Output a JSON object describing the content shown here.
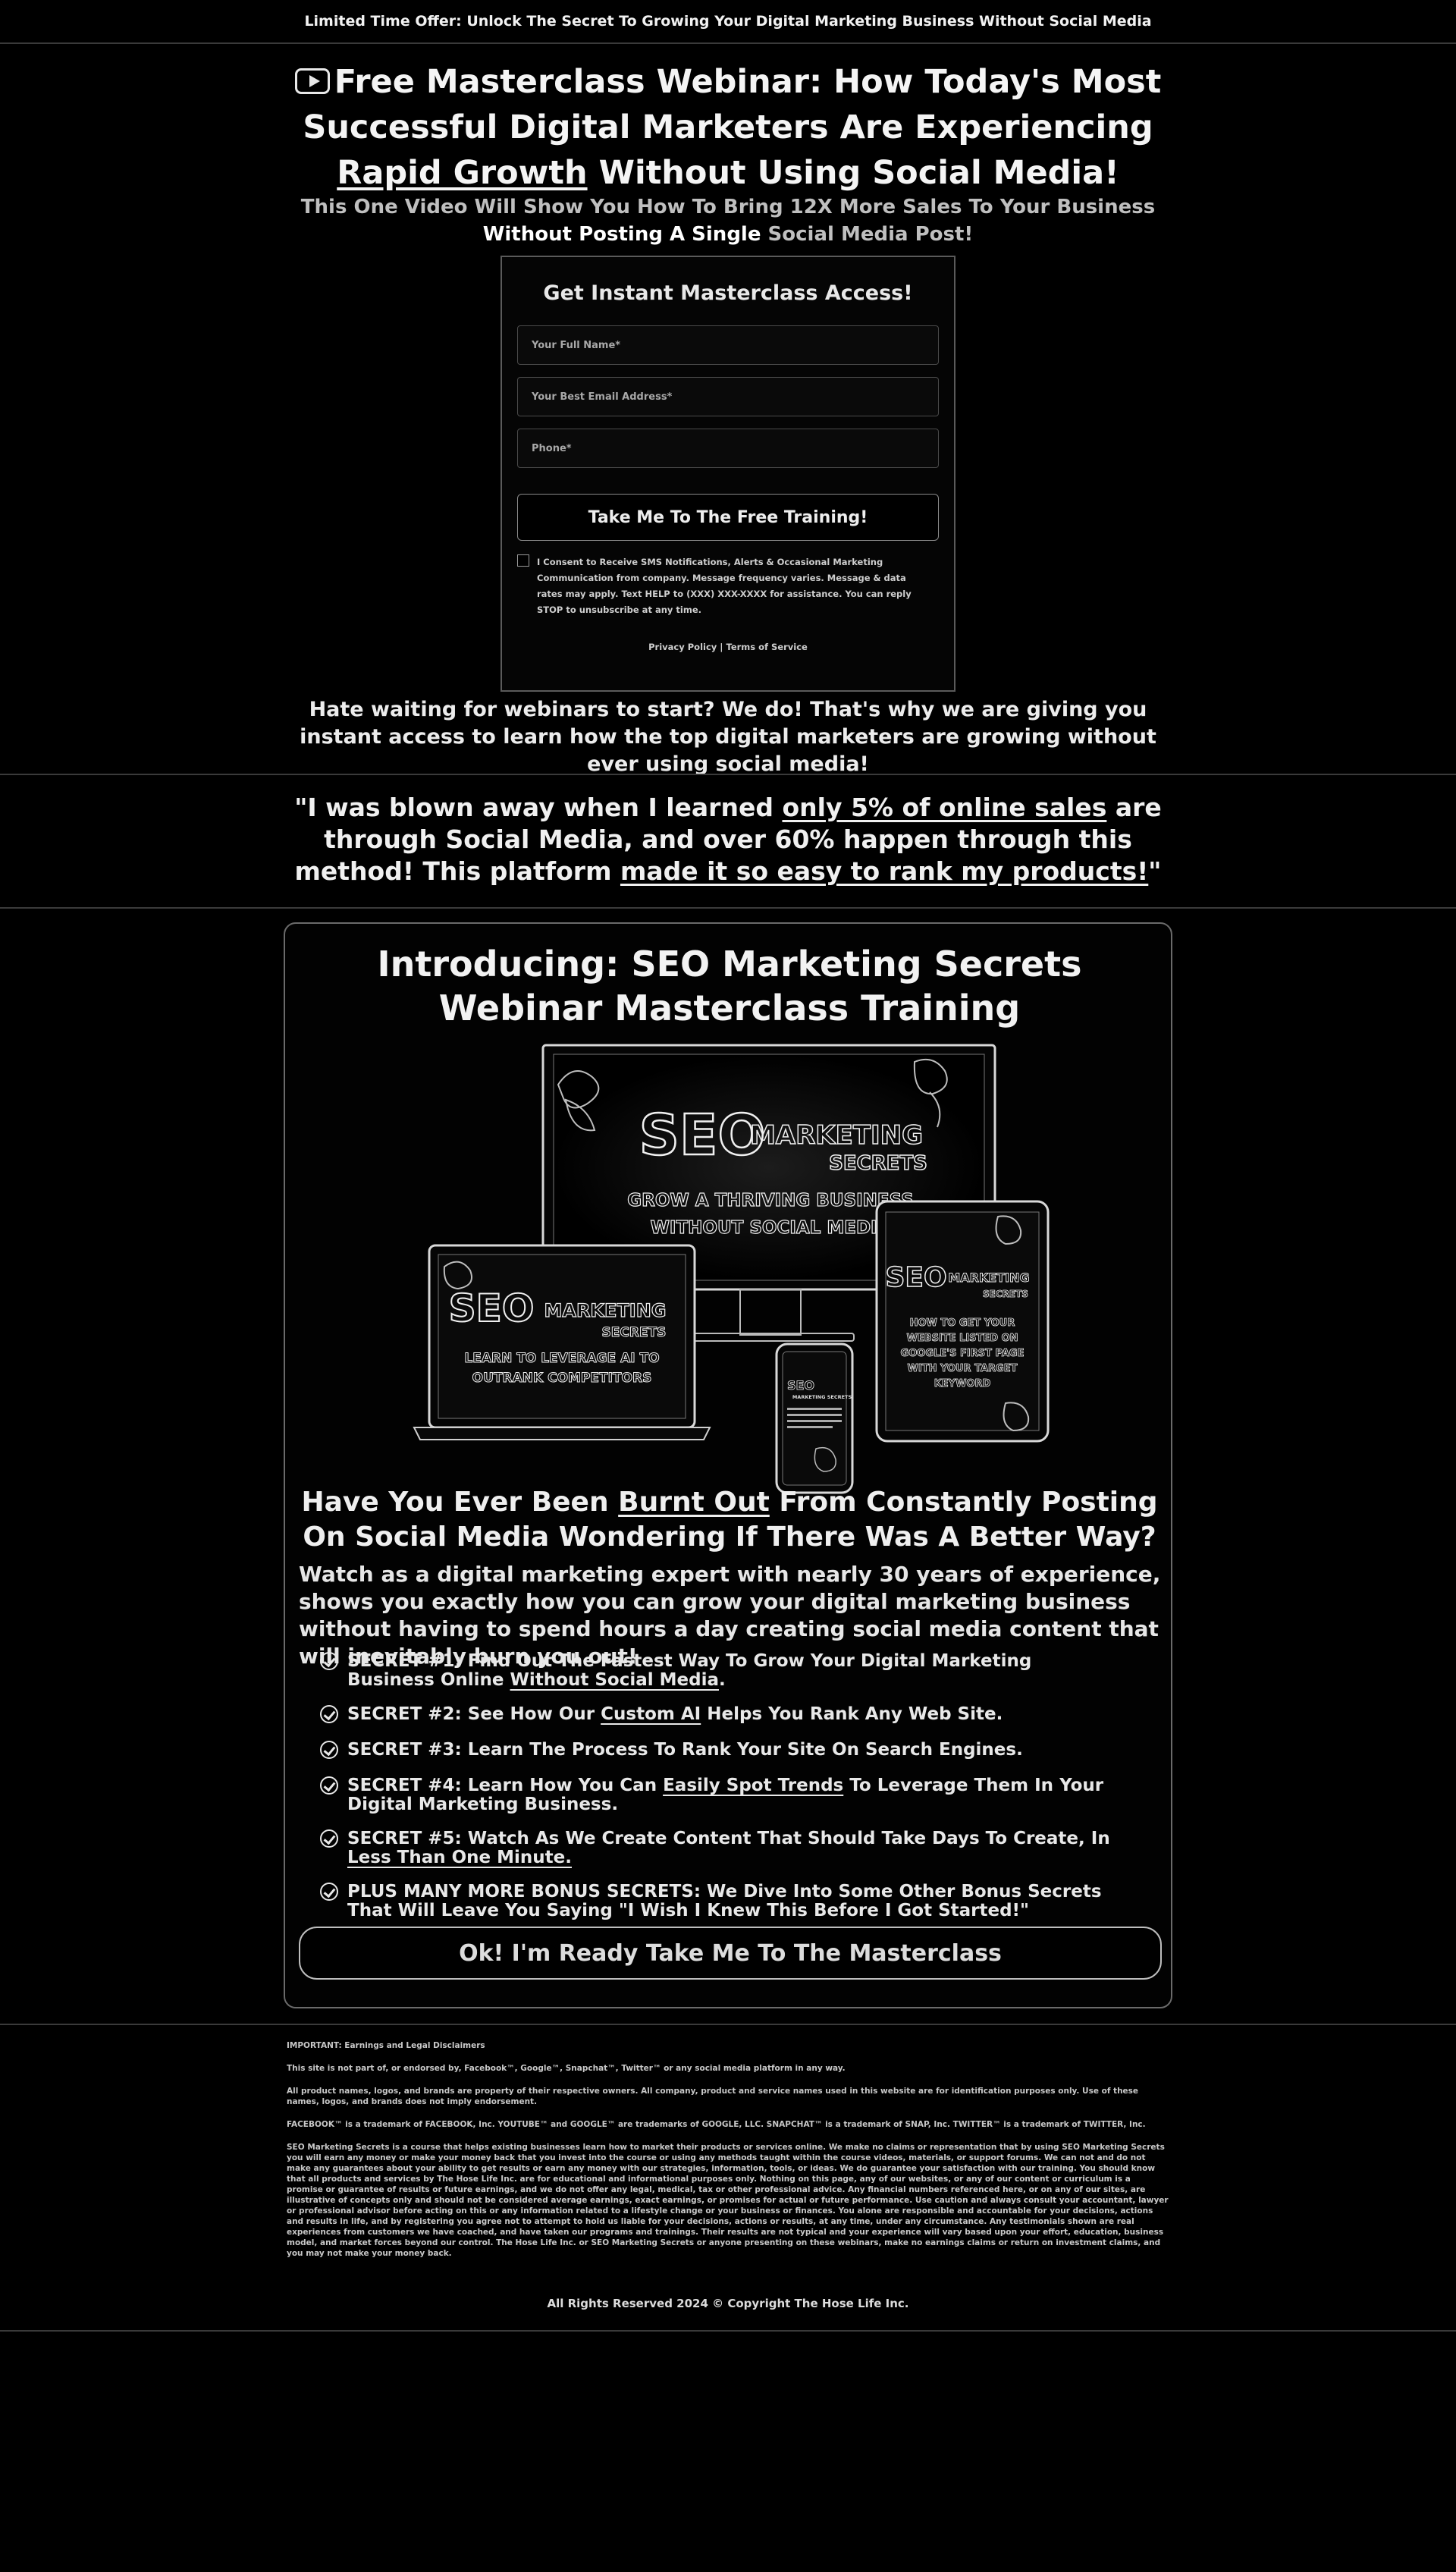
{
  "top_bar": {
    "text": "Limited Time Offer: Unlock The Secret To Growing Your Digital Marketing Business Without Social Media"
  },
  "headline": {
    "part1": "Free Masterclass Webinar: How Today's Most Successful Digital Marketers Are Experiencing",
    "part2_underlined": "Rapid Growth",
    "part3": "Without Using Social Media!"
  },
  "subhead": {
    "text1": "This One Video Will Show You How To Bring 12X More Sales To Your Business",
    "text2": "Without Posting A Single",
    "text3": "Social Media Post!"
  },
  "form": {
    "title": "Get Instant Masterclass Access!",
    "name_placeholder": "Your Full Name*",
    "email_placeholder": "Your Best Email Address*",
    "phone_placeholder": "Phone*",
    "submit_label": "Take Me To The Free Training!",
    "consent_text": "I Consent to Receive SMS Notifications, Alerts & Occasional Marketing Communication from company. Message frequency varies. Message & data rates may apply. Text HELP to (XXX) XXX-XXXX for assistance. You can reply STOP to unsubscribe at any time.",
    "privacy_label": "Privacy Policy",
    "separator": "|",
    "terms_label": "Terms of Service"
  },
  "waiting_text": "Hate waiting for webinars to start? We do! That's why we are giving you instant access to learn how the top digital marketers are growing without ever using social media!",
  "testimonial": {
    "part1": "\"I was blown away when I learned",
    "part2_underlined": "only 5% of online sales",
    "part3": "are through Social Media, and over 60% happen through this method! This platform",
    "part4_underlined": "made it so easy to rank my products!",
    "part5": "\""
  },
  "intro_title": "Introducing: SEO Marketing Secrets Webinar Masterclass Training",
  "devices_image": {
    "monitor": {
      "seo": "SEO",
      "marketing": "MARKETING",
      "secrets": "SECRETS",
      "line1": "GROW A THRIVING BUSINESS",
      "line2": "WITHOUT SOCIAL MEDIA"
    },
    "laptop": {
      "seo": "SEO",
      "marketing": "MARKETING",
      "secrets": "SECRETS",
      "line1": "LEARN TO LEVERAGE AI TO",
      "line2": "OUTRANK COMPETITORS"
    },
    "tablet": {
      "seo": "SEO",
      "marketing": "MARKETING",
      "secrets": "SECRETS",
      "line1": "HOW TO GET YOUR",
      "line2": "WEBSITE LISTED ON",
      "line3": "GOOGLE'S FIRST PAGE",
      "line4": "WITH YOUR TARGET",
      "line5": "KEYWORD"
    },
    "phone": {
      "seo": "SEO",
      "marketing": "MARKETING SECRETS"
    }
  },
  "burnout_heading": {
    "part1": "Have You Ever Been",
    "part2_underlined": "Burnt Out",
    "part3": "From Constantly Posting On Social Media Wondering If There Was A Better Way?"
  },
  "watch_text": "Watch as a digital marketing expert with nearly 30 years of experience, shows you exactly how you can grow your digital marketing business without having to spend hours a day creating social media content that will inevitably burn you out!",
  "secrets": [
    {
      "label": "SECRET #1:",
      "text": "Find Out The Fastest Way To Grow Your Digital Marketing Business Online",
      "underlined": "Without Social Media",
      "after": "."
    },
    {
      "label": "SECRET #2:",
      "text": "See How Our",
      "underlined": "Custom AI",
      "after": "Helps You Rank Any Web Site."
    },
    {
      "label": "SECRET #3:",
      "text": "Learn The Process To Rank Your Site On Search Engines.",
      "underlined": "",
      "after": ""
    },
    {
      "label": "SECRET #4:",
      "text": "Learn How You Can",
      "underlined": "Easily Spot Trends",
      "after": "To Leverage Them In Your Digital Marketing Business."
    },
    {
      "label": "SECRET #5:",
      "text": "Watch As We Create Content That Should Take Days To Create, In",
      "underlined": "Less Than One Minute.",
      "after": ""
    },
    {
      "label": "PLUS MANY MORE BONUS SECRETS:",
      "text": "We Dive Into Some Other Bonus Secrets That Will Leave You Saying \"I Wish I Knew This Before I Got Started!\"",
      "underlined": "",
      "after": ""
    }
  ],
  "cta_label": "Ok! I'm Ready Take Me To The Masterclass",
  "footer": {
    "title": "IMPORTANT: Earnings and Legal Disclaimers",
    "p1": "This site is not part of, or endorsed by, Facebook™, Google™, Snapchat™, Twitter™ or any social media platform in any way.",
    "p2": "All product names, logos, and brands are property of their respective owners. All company, product and service names used in this website are for identification purposes only. Use of these names, logos, and brands does not imply endorsement.",
    "p3": "FACEBOOK™ is a trademark of FACEBOOK, Inc. YOUTUBE™ and GOOGLE™ are trademarks of GOOGLE, LLC. SNAPCHAT™ is a trademark of SNAP, Inc. TWITTER™ is a trademark of TWITTER, Inc.",
    "p4": "SEO Marketing Secrets is a course that helps existing businesses learn how to market their products or services online. We make no claims or representation that by using SEO Marketing Secrets you will earn any money or make your money back that you invest into the course or using any methods taught within the course videos, materials, or support forums. We can not and do not make any guarantees about your ability to get results or earn any money with our strategies, information, tools, or ideas. We do guarantee your satisfaction with our training. You should know that all products and services by The Hose Life Inc. are for educational and informational purposes only. Nothing on this page, any of our websites, or any of our content or curriculum is a promise or guarantee of results or future earnings, and we do not offer any legal, medical, tax or other professional advice. Any financial numbers referenced here, or on any of our sites, are illustrative of concepts only and should not be considered average earnings, exact earnings, or promises for actual or future performance. Use caution and always consult your accountant, lawyer or professional advisor before acting on this or any information related to a lifestyle change or your business or finances. You alone are responsible and accountable for your decisions, actions and results in life, and by registering you agree not to attempt to hold us liable for your decisions, actions or results, at any time, under any circumstance. Any testimonials shown are real experiences from customers we have coached, and have taken our programs and trainings. Their results are not typical and your experience will vary based upon your effort, education, business model, and market forces beyond our control. The Hose Life Inc. or SEO Marketing Secrets or anyone presenting on these webinars, make no earnings claims or return on investment claims, and you may not make your money back."
  },
  "copyright": "All Rights Reserved 2024 © Copyright The Hose Life Inc."
}
